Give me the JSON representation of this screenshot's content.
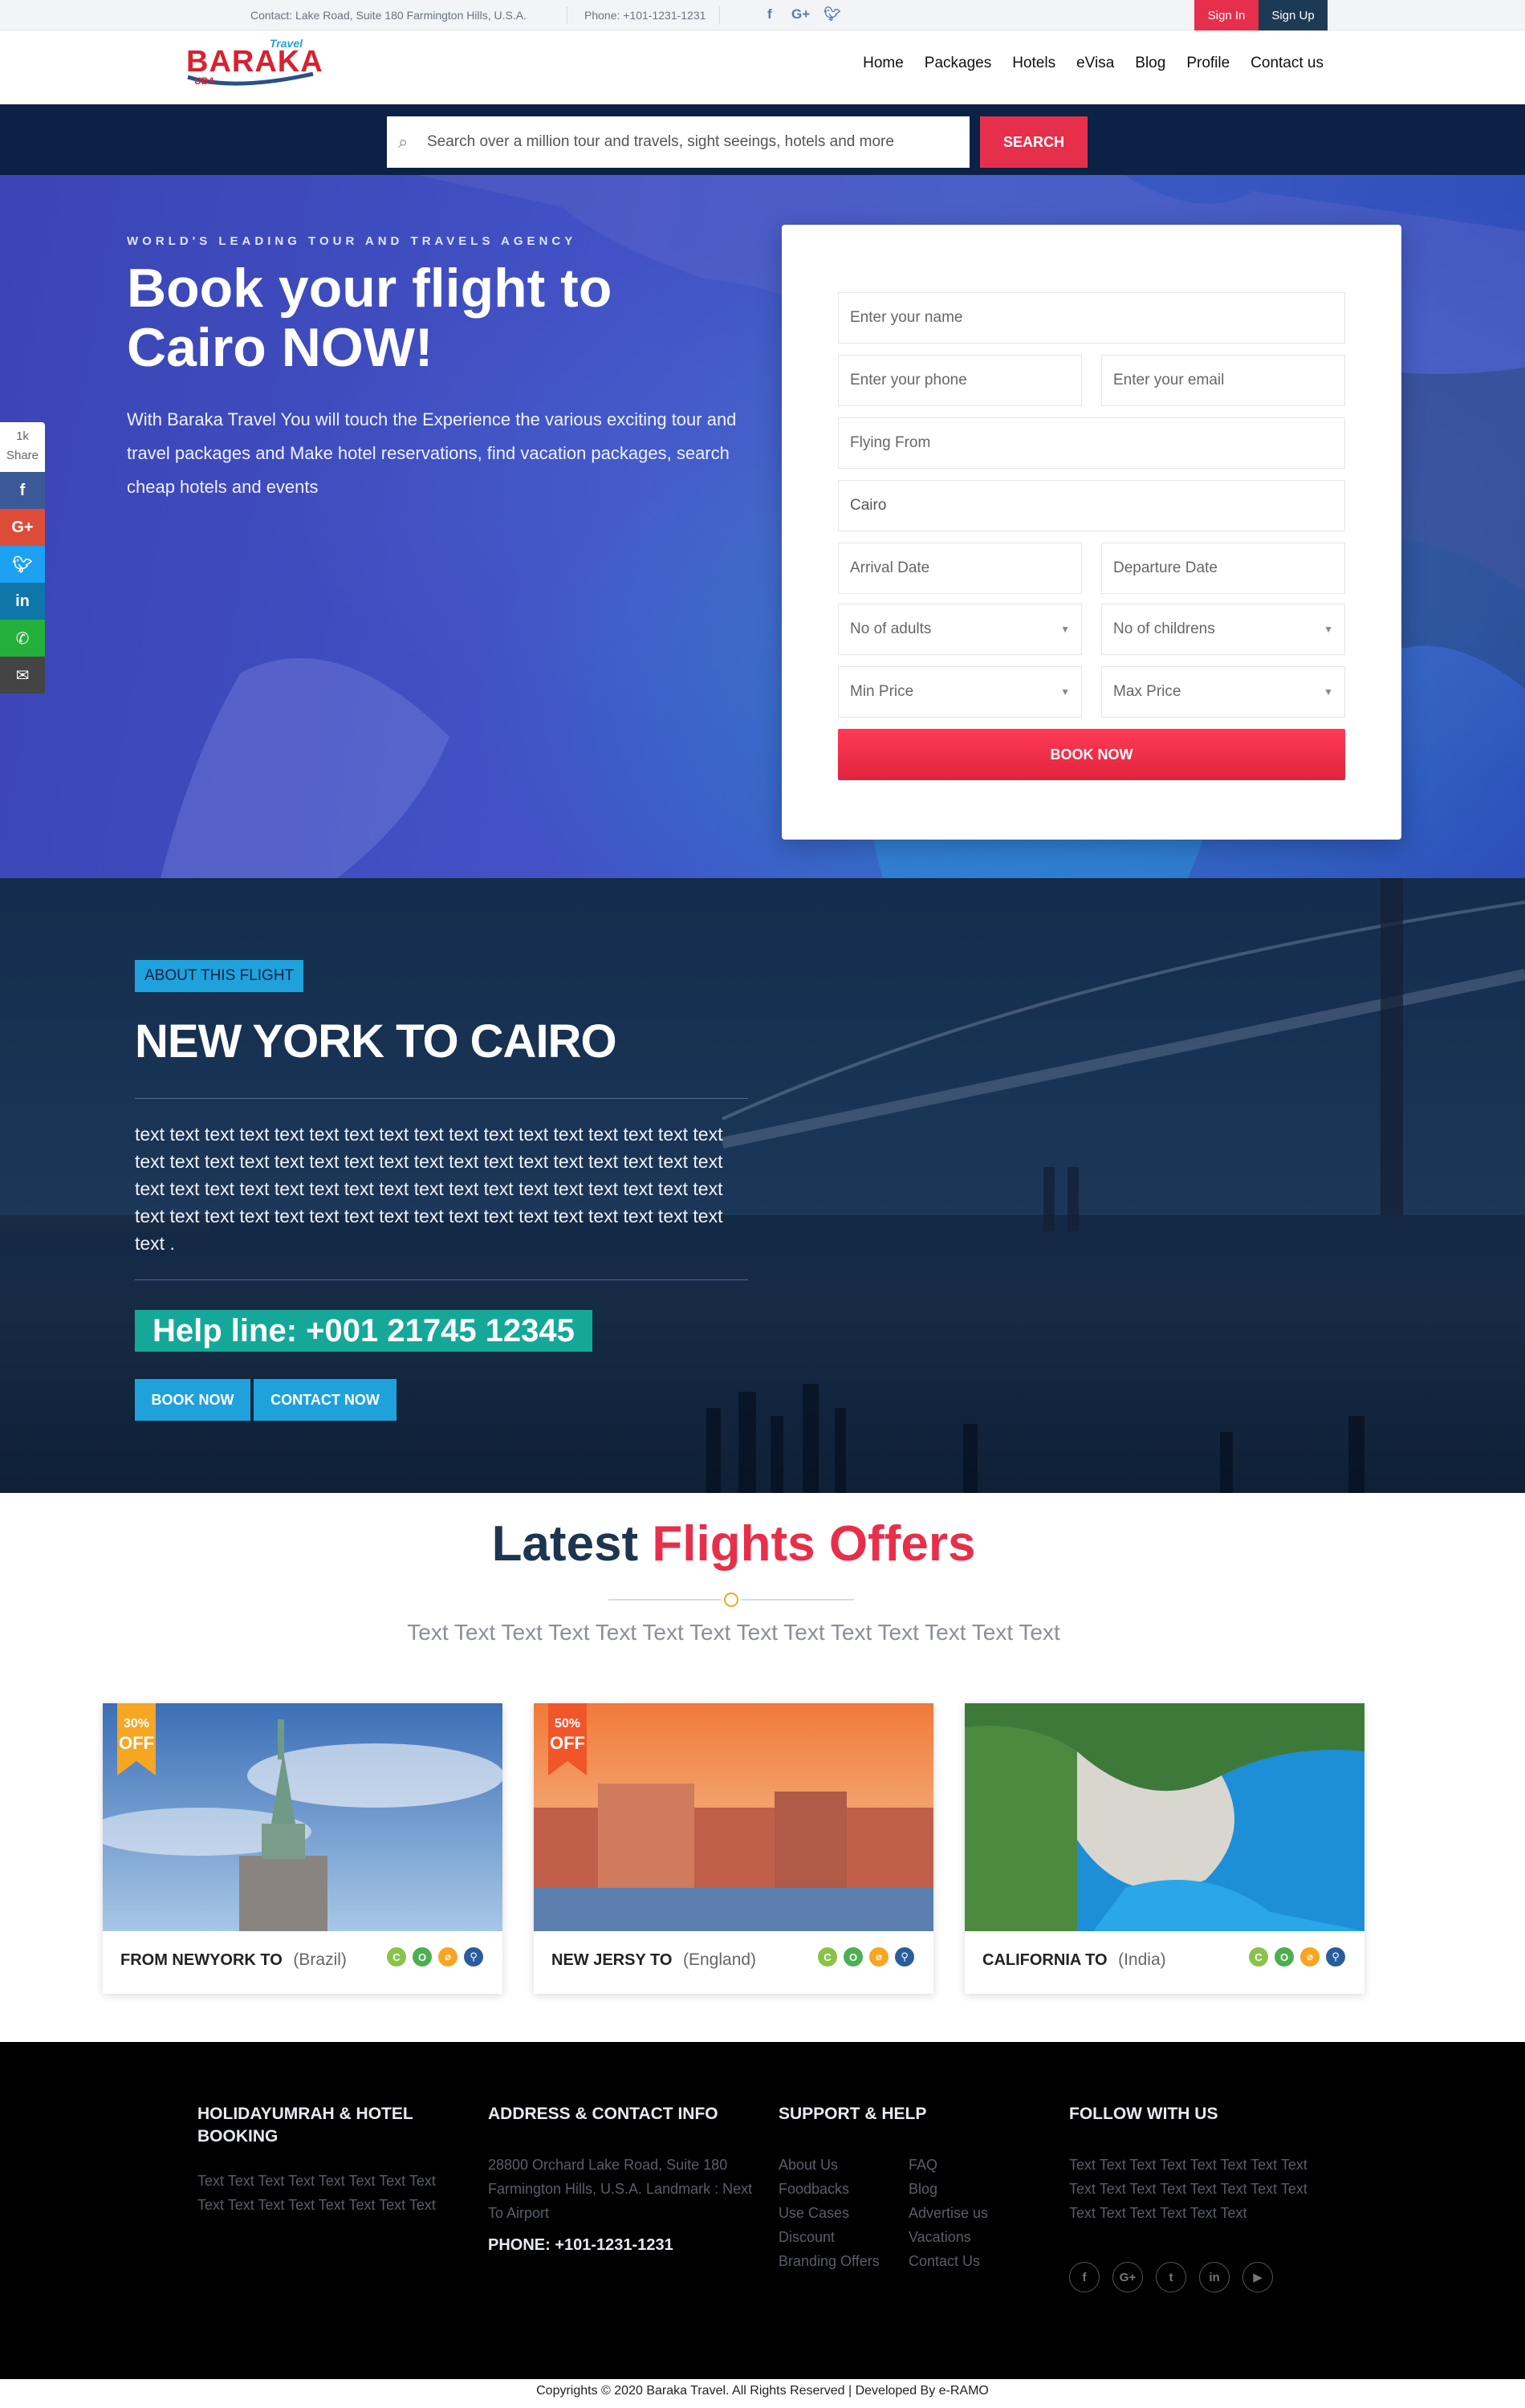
{
  "topbar": {
    "contact": "Contact: Lake Road, Suite 180 Farmington Hills, U.S.A.",
    "phone": "Phone: +101-1231-1231",
    "social": [
      "facebook-icon",
      "google-plus-icon",
      "twitter-icon"
    ],
    "sign_in": "Sign In",
    "sign_up": "Sign Up"
  },
  "logo": {
    "small": "Travel",
    "main": "BARAKA",
    "sub": "UBA"
  },
  "nav": {
    "items": [
      "Home",
      "Packages",
      "Hotels",
      "eVisa",
      "Blog",
      "Profile",
      "Contact us"
    ]
  },
  "search": {
    "placeholder": "Search over a million tour and travels, sight seeings, hotels and more",
    "button": "SEARCH"
  },
  "hero": {
    "tag": "WORLD'S LEADING TOUR AND TRAVELS AGENCY",
    "title": "Book your flight to Cairo NOW!",
    "description": "With Baraka Travel You will touch the Experience the various exciting tour and travel packages and Make hotel reservations, find vacation packages, search cheap hotels and events"
  },
  "share": {
    "count": "1k",
    "label": "Share",
    "items": [
      {
        "icon": "f",
        "name": "facebook-share-icon",
        "color": "#3b5998"
      },
      {
        "icon": "G+",
        "name": "google-plus-share-icon",
        "color": "#dd4b39"
      },
      {
        "icon": "t",
        "name": "twitter-share-icon",
        "color": "#1da1f2"
      },
      {
        "icon": "in",
        "name": "linkedin-share-icon",
        "color": "#0e76a8"
      },
      {
        "icon": "✆",
        "name": "whatsapp-share-icon",
        "color": "#25b03b"
      },
      {
        "icon": "✉",
        "name": "email-share-icon",
        "color": "#444"
      }
    ]
  },
  "form": {
    "name": "Enter your name",
    "phone": "Enter your phone",
    "email": "Enter your email",
    "flying_from": "Flying From",
    "destination": "Cairo",
    "arrival": "Arrival Date",
    "departure": "Departure Date",
    "adults": "No of adults",
    "children": "No of childrens",
    "min_price": "Min Price",
    "max_price": "Max Price",
    "book": "BOOK NOW"
  },
  "about": {
    "tag": "ABOUT THIS FLIGHT",
    "title": "NEW YORK TO CAIRO",
    "text": "text text text text text text text text text text text text text text text text text text text text text text text text text text text text text text text text text text text text text text text text text text text text text text text text text text text text text text text text text text text text text text text text text text text text text .",
    "helpline": "Help line: +001 21745 12345",
    "book_now": "BOOK NOW",
    "contact_now": "CONTACT NOW"
  },
  "offers": {
    "title_part1": "Latest",
    "title_part2": "Flights Offers",
    "subtitle": "Text Text Text Text Text Text Text Text Text Text Text Text Text Text",
    "cards": [
      {
        "label": "FROM NEWYORK TO",
        "country": "(Brazil)",
        "discount": "30%",
        "off": "OFF",
        "ribbon_color": "#f5a623"
      },
      {
        "label": "NEW JERSY TO",
        "country": "(England)",
        "discount": "50%",
        "off": "OFF",
        "ribbon_color": "#f0562a"
      },
      {
        "label": "CALIFORNIA TO",
        "country": "(India)",
        "discount": "",
        "off": "",
        "ribbon_color": ""
      }
    ],
    "card_icons": [
      {
        "glyph": "C",
        "color": "#8bc34a"
      },
      {
        "glyph": "O",
        "color": "#4caf50"
      },
      {
        "glyph": "⌀",
        "color": "#f5a623"
      },
      {
        "glyph": "⚲",
        "color": "#2b5d9c"
      }
    ]
  },
  "footer": {
    "col1_title": "HOLIDAYUMRAH & HOTEL BOOKING",
    "col1_text": "Text Text Text Text Text Text Text Text Text Text Text Text Text Text Text Text",
    "col2_title": "ADDRESS & CONTACT INFO",
    "col2_text": "28800 Orchard Lake Road, Suite 180 Farmington Hills, U.S.A. Landmark : Next To Airport",
    "col2_phone": "PHONE: +101-1231-1231",
    "col3_title": "SUPPORT & HELP",
    "col3_left": [
      "About Us",
      "Foodbacks",
      "Use Cases",
      "Discount",
      "Branding Offers"
    ],
    "col3_right": [
      "FAQ",
      "Blog",
      "Advertise us",
      "Vacations",
      "Contact Us"
    ],
    "col4_title": "FOLLOW WITH US",
    "col4_text": "Text Text Text Text Text Text Text Text Text Text Text Text Text Text Text Text Text Text Text Text Text Text",
    "social": [
      "f",
      "G+",
      "t",
      "in",
      "▶"
    ]
  },
  "copyright": "Copyrights © 2020 Baraka Travel. All Rights Reserved | Developed By e-RAMO"
}
